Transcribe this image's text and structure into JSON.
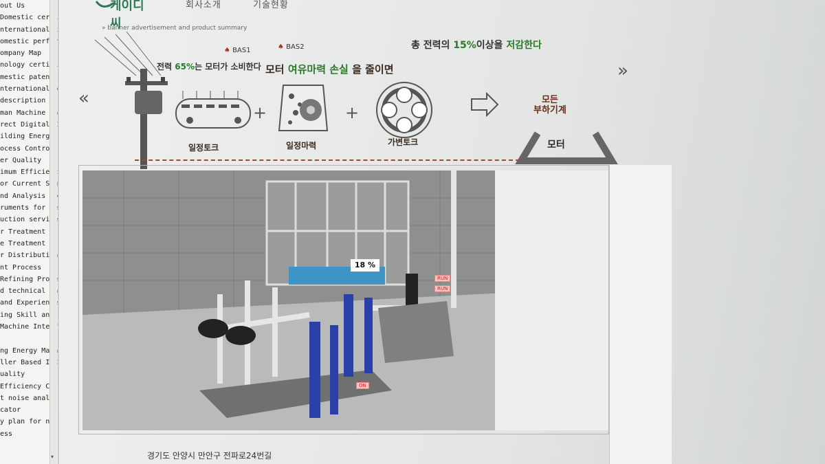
{
  "sidebar": {
    "items": [
      "out Us",
      "Domestic certificati",
      "nternational certifi",
      "omestic performance",
      "ompany Map",
      "nology certificatic",
      "mestic patent",
      "nternational patent",
      " description",
      "man Machine Interfa",
      "rect Digital Contro",
      "ilding Energy Manag",
      "ocess Control Syste",
      "er Quality",
      "imum Efficiency Co",
      "or Current Signatu",
      "nd Analysis for Ai",
      "ruments for Senso",
      "uction service",
      "r Treatment",
      "e Treatment",
      "r Distribution",
      "nt Process",
      " Refining Proces",
      "d technical date",
      " and Experience",
      "ing Skill and Ex",
      " Machine Interfa",
      "",
      "ng Energy Manas",
      "ller Based IEC",
      "uality",
      " Efficiency Cc",
      "t noise analy",
      "cator",
      "y plan for ne",
      "ess"
    ],
    "scroll_arrow": "▾"
  },
  "nav": {
    "logo": "케이디씨",
    "menu": [
      "회사소개",
      "기술현황"
    ]
  },
  "banner": {
    "caption": "» banner advertisement and product summary",
    "line1_prefix": "전력 ",
    "line1_highlight": "65%",
    "line1_suffix": "는 모터가 소비한다",
    "line2_prefix": "모터 ",
    "line2_highlight": "여유마력 손실",
    "line2_suffix": " 을 줄이면",
    "line3_prefix": "총 전력의 ",
    "line3_highlight": "15%",
    "line3_middle": "이상을 ",
    "line3_saving": "저감한다",
    "bas1": "BAS1",
    "bas2": "BAS2",
    "label_constant_torque": "일정토크",
    "label_constant_power": "일정마력",
    "label_variable_torque": "가변토크",
    "all_loads_line1": "모든",
    "all_loads_line2": "부하기계",
    "motor": "모터",
    "plus": "+",
    "arrow_left": "«",
    "arrow_right": "»"
  },
  "render": {
    "percent": "18 %",
    "tag_run1": "RUN",
    "tag_run2": "RUN",
    "tag_on": "ON"
  },
  "footer": {
    "address": "경기도 안양시 만안구 전파로24번길"
  },
  "colors": {
    "accent_green": "#2a7a2a",
    "brand_brown": "#3b2a1e",
    "pipe_blue": "#2a3fa8"
  }
}
